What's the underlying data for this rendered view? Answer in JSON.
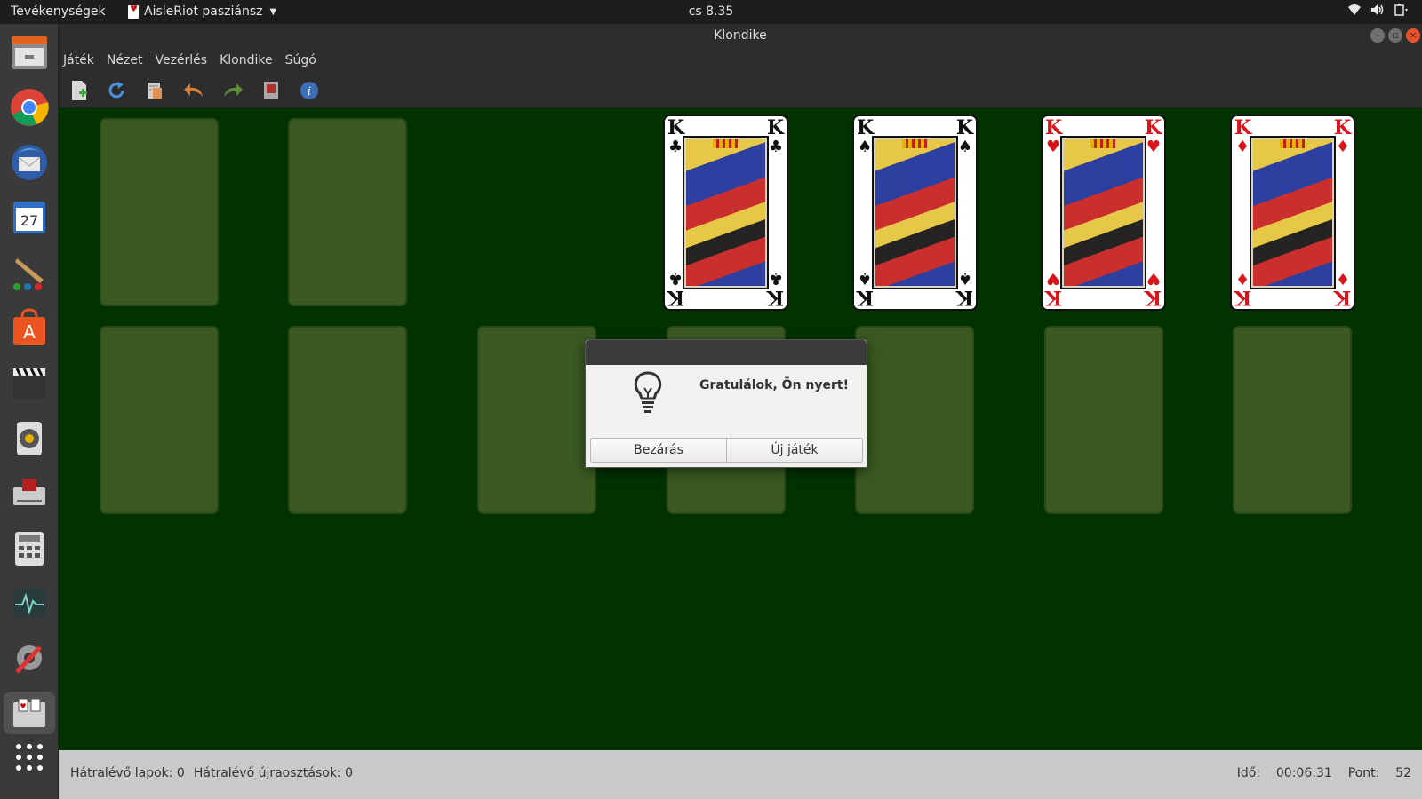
{
  "topbar": {
    "activities": "Tevékenységek",
    "app_name": "AisleRiot pasziánsz",
    "clock": "cs  8.35"
  },
  "dock": {
    "items": [
      "files-icon",
      "chrome-icon",
      "thunderbird-icon",
      "calendar-icon",
      "paint-icon",
      "software-center-icon",
      "video-editor-icon",
      "music-player-icon",
      "scanner-icon",
      "calculator-icon",
      "system-monitor-icon",
      "settings-icon",
      "aisleriot-icon",
      "app-grid-icon"
    ],
    "calendar_day": "27"
  },
  "window": {
    "title": "Klondike",
    "menu": [
      "Játék",
      "Nézet",
      "Vezérlés",
      "Klondike",
      "Súgó"
    ]
  },
  "foundations": [
    {
      "rank": "K",
      "suit": "♣",
      "color": "#111111"
    },
    {
      "rank": "K",
      "suit": "♠",
      "color": "#111111"
    },
    {
      "rank": "K",
      "suit": "♥",
      "color": "#d8151b"
    },
    {
      "rank": "K",
      "suit": "♦",
      "color": "#d8151b"
    }
  ],
  "dialog": {
    "message": "Gratulálok, Ön nyert!",
    "close_label": "Bezárás",
    "new_game_label": "Új játék"
  },
  "status": {
    "cards_left": "Hátralévő lapok: 0",
    "redeals_left": "Hátralévő újraosztások: 0",
    "time_label": "Idő:",
    "time_value": "00:06:31",
    "score_label": "Pont:",
    "score_value": "52"
  },
  "colors": {
    "felt": "#013200",
    "slot": "#3a5a22"
  }
}
